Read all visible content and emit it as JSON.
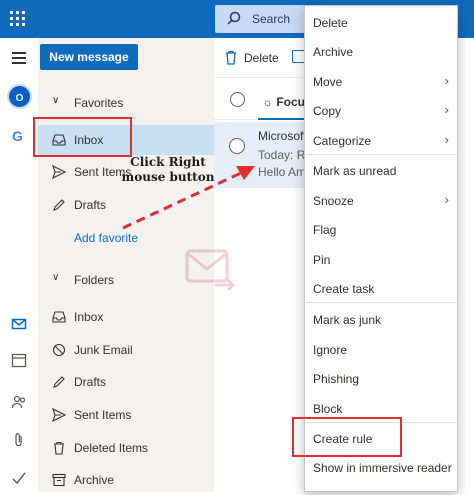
{
  "topbar": {
    "search_label": "Search"
  },
  "rail": {
    "outlook_badge": "O",
    "google_badge": "G"
  },
  "toolbar": {
    "new_message": "New message",
    "delete": "Delete"
  },
  "folders_pane": {
    "favorites_header": "Favorites",
    "favorites": [
      {
        "label": "Inbox",
        "icon": "inbox-icon"
      },
      {
        "label": "Sent Items",
        "icon": "send-icon"
      },
      {
        "label": "Drafts",
        "icon": "pencil-icon"
      }
    ],
    "add_favorite": "Add favorite",
    "folders_header": "Folders",
    "folders": [
      {
        "label": "Inbox",
        "icon": "inbox-icon"
      },
      {
        "label": "Junk Email",
        "icon": "block-icon"
      },
      {
        "label": "Drafts",
        "icon": "pencil-icon"
      },
      {
        "label": "Sent Items",
        "icon": "send-icon"
      },
      {
        "label": "Deleted Items",
        "icon": "trash-icon"
      },
      {
        "label": "Archive",
        "icon": "archive-icon"
      }
    ]
  },
  "message_list": {
    "tab_focused": "Focuse",
    "message": {
      "from": "Microsoft",
      "subject": "Today: Re",
      "preview": "Hello Am"
    }
  },
  "context_menu": {
    "items": [
      {
        "label": "Delete",
        "submenu": false
      },
      {
        "label": "Archive",
        "submenu": false
      },
      {
        "label": "Move",
        "submenu": true
      },
      {
        "label": "Copy",
        "submenu": true
      },
      {
        "label": "Categorize",
        "submenu": true
      },
      {
        "label": "Mark as unread",
        "submenu": false
      },
      {
        "label": "Snooze",
        "submenu": true
      },
      {
        "label": "Flag",
        "submenu": false
      },
      {
        "label": "Pin",
        "submenu": false
      },
      {
        "label": "Create task",
        "submenu": false
      },
      {
        "label": "Mark as junk",
        "submenu": false
      },
      {
        "label": "Ignore",
        "submenu": false
      },
      {
        "label": "Phishing",
        "submenu": false
      },
      {
        "label": "Block",
        "submenu": false
      },
      {
        "label": "Create rule",
        "submenu": false
      },
      {
        "label": "Show in immersive reader",
        "submenu": false
      }
    ]
  },
  "annotation": {
    "line1": "Click Right",
    "line2": "mouse button"
  },
  "colors": {
    "brand": "#0f6cbd",
    "annotation_red": "#e02e2e",
    "selected_bg": "#c7e0f4"
  }
}
